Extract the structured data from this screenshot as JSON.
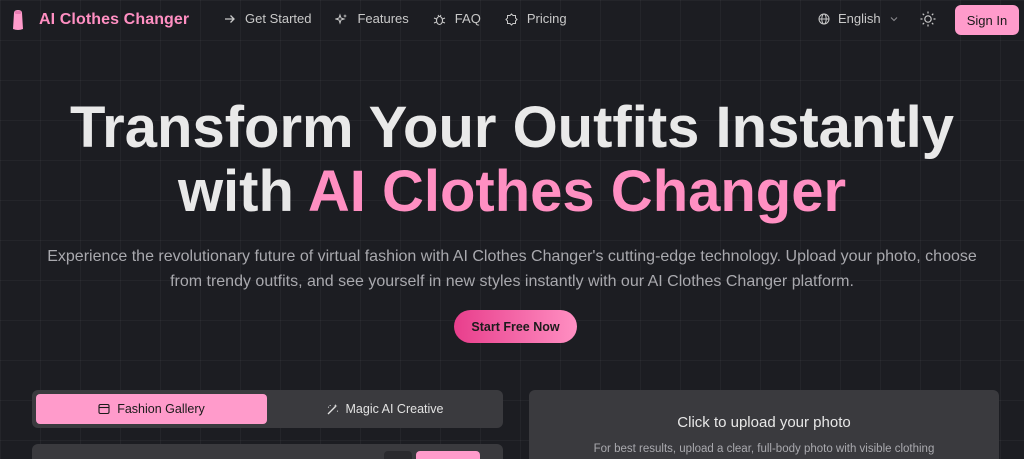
{
  "brand": {
    "name": "AI Clothes Changer"
  },
  "nav": {
    "links": [
      {
        "label": "Get Started",
        "icon": "arrow-right-icon"
      },
      {
        "label": "Features",
        "icon": "sparkles-icon"
      },
      {
        "label": "FAQ",
        "icon": "bug-icon"
      },
      {
        "label": "Pricing",
        "icon": "badge-icon"
      }
    ],
    "language": "English",
    "signin_label": "Sign In"
  },
  "hero": {
    "title_line1": "Transform Your Outfits Instantly",
    "title_with": "with",
    "title_accent": "AI Clothes Changer",
    "subtitle": "Experience the revolutionary future of virtual fashion with AI Clothes Changer's cutting-edge technology. Upload your photo, choose from trendy outfits, and see yourself in new styles instantly with our AI Clothes Changer platform.",
    "cta_label": "Start Free Now"
  },
  "tabs": [
    {
      "label": "Fashion Gallery",
      "icon": "gallery-icon",
      "active": true
    },
    {
      "label": "Magic AI Creative",
      "icon": "magic-wand-icon",
      "active": false
    }
  ],
  "upload": {
    "title": "Click to upload your photo",
    "hint": "For best results, upload a clear, full-body photo with visible clothing"
  },
  "colors": {
    "accent": "#ff8fc2",
    "button": "#ff9bcb",
    "background": "#1c1d22",
    "panel": "#3a3a3e"
  }
}
